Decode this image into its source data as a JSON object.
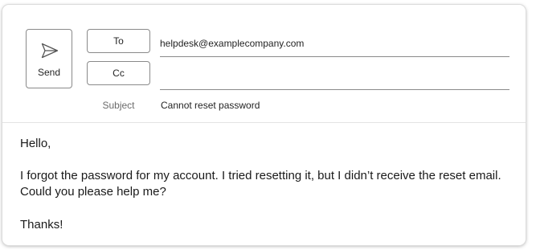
{
  "compose": {
    "send_label": "Send",
    "to_label": "To",
    "cc_label": "Cc",
    "to_value": "helpdesk@examplecompany.com",
    "cc_value": "",
    "subject_label": "Subject",
    "subject_value": "Cannot reset password"
  },
  "body": {
    "greeting": "Hello,",
    "paragraph": "I forgot the password for my account. I tried resetting it, but I didn’t receive the reset email. Could you please help me?",
    "closing": "Thanks!"
  },
  "icons": {
    "send": "send-icon"
  }
}
